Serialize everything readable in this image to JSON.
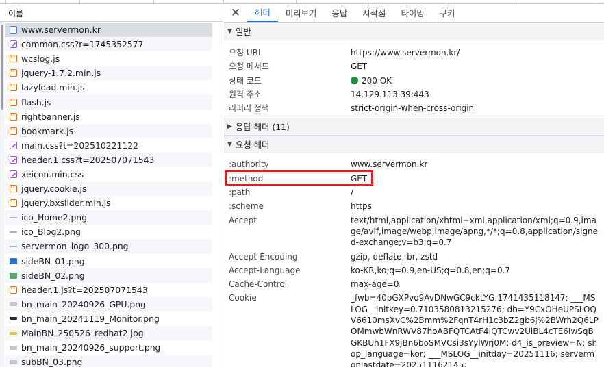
{
  "accent_color": "#1a73e8",
  "highlight_color": "#e01e23",
  "left_pane": {
    "column_header": "이름",
    "requests": [
      {
        "name": "www.servermon.kr",
        "icon": "document-icon",
        "selected": true
      },
      {
        "name": "common.css?r=1745352577",
        "icon": "stylesheet-icon"
      },
      {
        "name": "wcslog.js",
        "icon": "script-icon"
      },
      {
        "name": "jquery-1.7.2.min.js",
        "icon": "script-icon"
      },
      {
        "name": "lazyload.min.js",
        "icon": "script-icon"
      },
      {
        "name": "flash.js",
        "icon": "script-icon"
      },
      {
        "name": "rightbanner.js",
        "icon": "script-icon"
      },
      {
        "name": "bookmark.js",
        "icon": "script-icon"
      },
      {
        "name": "main.css?t=202510221122",
        "icon": "stylesheet-icon"
      },
      {
        "name": "header.1.css?t=202507071543",
        "icon": "stylesheet-icon"
      },
      {
        "name": "xeicon.min.css",
        "icon": "stylesheet-icon"
      },
      {
        "name": "jquery.cookie.js",
        "icon": "script-icon"
      },
      {
        "name": "jquery.bxslider.min.js",
        "icon": "script-icon"
      },
      {
        "name": "ico_Home2.png",
        "icon": "image-thumb-icon"
      },
      {
        "name": "ico_Blog2.png",
        "icon": "image-thumb-icon"
      },
      {
        "name": "servermon_logo_300.png",
        "icon": "image-thumb-icon"
      },
      {
        "name": "sideBN_01.png",
        "icon": "image-thumb-icon"
      },
      {
        "name": "sideBN_02.png",
        "icon": "image-thumb-icon"
      },
      {
        "name": "header.1.js?t=202507071543",
        "icon": "script-icon"
      },
      {
        "name": "bn_main_20240926_GPU.png",
        "icon": "image-thumb-icon"
      },
      {
        "name": "bn_main_20241119_Monitor.png",
        "icon": "image-thumb-icon"
      },
      {
        "name": "MainBN_250526_redhat2.jpg",
        "icon": "image-thumb-icon"
      },
      {
        "name": "bn_main_20240926_support.png",
        "icon": "image-thumb-icon"
      },
      {
        "name": "subBN_03.png",
        "icon": "image-thumb-icon"
      }
    ]
  },
  "right_pane": {
    "tabs": [
      {
        "label": "헤더",
        "active": true
      },
      {
        "label": "미리보기"
      },
      {
        "label": "응답"
      },
      {
        "label": "시작점"
      },
      {
        "label": "타이밍"
      },
      {
        "label": "쿠키"
      }
    ],
    "general": {
      "title": "일반",
      "rows": [
        {
          "key": "요청 URL",
          "value": "https://www.servermon.kr/"
        },
        {
          "key": "요청 메서드",
          "value": "GET"
        },
        {
          "key": "상태 코드",
          "value": "200 OK"
        },
        {
          "key": "원격 주소",
          "value": "14.129.113.39:443"
        },
        {
          "key": "리퍼러 정책",
          "value": "strict-origin-when-cross-origin"
        }
      ]
    },
    "response_headers": {
      "title": "응답 헤더 (11)"
    },
    "request_headers": {
      "title": "요청 헤더",
      "rows": [
        {
          "key": ":authority",
          "value": "www.servermon.kr"
        },
        {
          "key": ":method",
          "value": "GET"
        },
        {
          "key": ":path",
          "value": "/"
        },
        {
          "key": ":scheme",
          "value": "https"
        },
        {
          "key": "Accept",
          "value": "text/html,application/xhtml+xml,application/xml;q=0.9,image/avif,image/webp,image/apng,*/*;q=0.8,application/signed-exchange;v=b3;q=0.7"
        },
        {
          "key": "Accept-Encoding",
          "value": "gzip, deflate, br, zstd"
        },
        {
          "key": "Accept-Language",
          "value": "ko-KR,ko;q=0.9,en-US;q=0.8,en;q=0.7"
        },
        {
          "key": "Cache-Control",
          "value": "max-age=0"
        },
        {
          "key": "Cookie",
          "value": "_fwb=40pGXPvo9AvDNwGC9ckLYG.1741435118147; ___MSLOG__initkey=0.7103580813215276; db=Y9CxOHeUPSLOQV6610msXvC%2Bmm%2FqnT4rH1c3bZ2gb6j%2BWrh2Q6LPOMmwbWnRWV87hoABFQTCAtF4IQTCwv2UiBL4cTE6IwSqBGKBUh1FX9jBn6boSMVCsi3sYylWrj0M; d4_is_preview=N; shop_language=kor; ___MSLOG__initday=20251116; servermonlastdate=202511162145;"
        }
      ]
    }
  }
}
